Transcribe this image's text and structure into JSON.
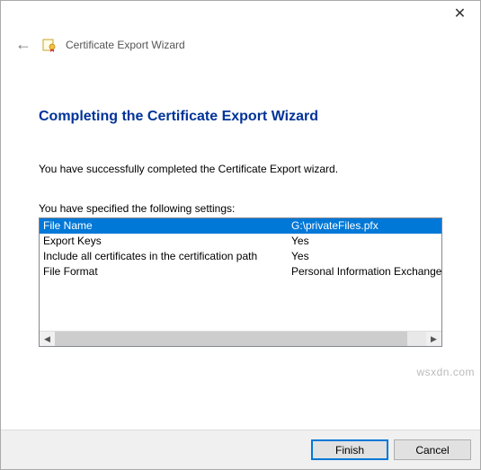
{
  "window": {
    "close_glyph": "✕"
  },
  "header": {
    "back_glyph": "←",
    "title": "Certificate Export Wizard"
  },
  "page": {
    "heading": "Completing the Certificate Export Wizard",
    "success_text": "You have successfully completed the Certificate Export wizard.",
    "settings_label": "You have specified the following settings:"
  },
  "settings": {
    "rows": [
      {
        "key": "File Name",
        "value": "G:\\privateFiles.pfx",
        "selected": true
      },
      {
        "key": "Export Keys",
        "value": "Yes",
        "selected": false
      },
      {
        "key": "Include all certificates in the certification path",
        "value": "Yes",
        "selected": false
      },
      {
        "key": "File Format",
        "value": "Personal Information Exchange (*.pfx)",
        "selected": false
      }
    ]
  },
  "scrollbar": {
    "left_glyph": "◀",
    "right_glyph": "▶"
  },
  "footer": {
    "finish": "Finish",
    "cancel": "Cancel"
  },
  "watermark": "wsxdn.com"
}
